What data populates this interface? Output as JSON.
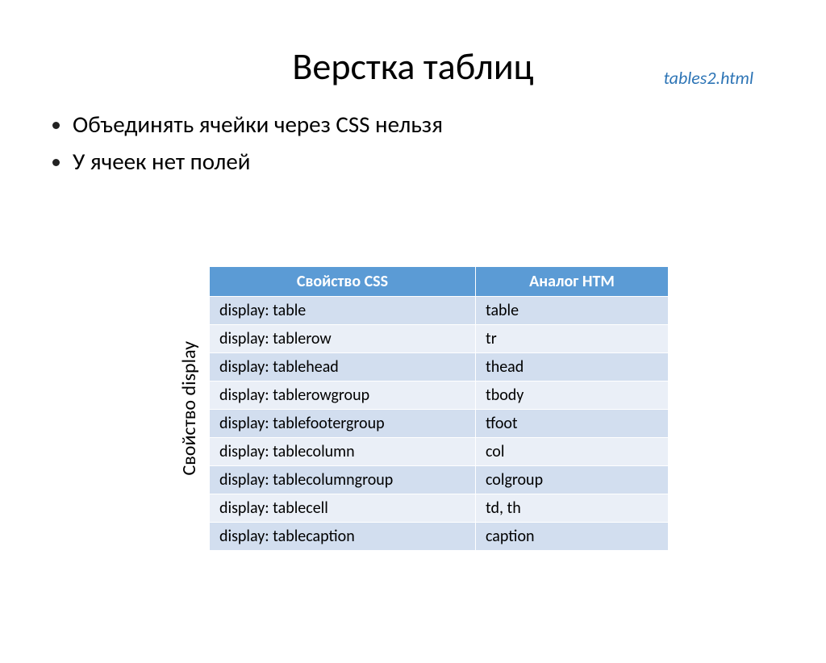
{
  "filename": "tables2.html",
  "title": "Верстка таблиц",
  "bullets": {
    "item0": "Объединять ячейки через CSS нельзя",
    "item1": "У ячеек нет полей"
  },
  "table": {
    "ylabel": "Свойство display",
    "headers": {
      "col0": "Свойство CSS",
      "col1": "Аналог HTM"
    },
    "rows": {
      "r0": {
        "c0": "display: table",
        "c1": "table"
      },
      "r1": {
        "c0": "display: tablerow",
        "c1": "tr"
      },
      "r2": {
        "c0": "display: tablehead",
        "c1": "thead"
      },
      "r3": {
        "c0": "display: tablerowgroup",
        "c1": "tbody"
      },
      "r4": {
        "c0": "display: tablefootergroup",
        "c1": "tfoot"
      },
      "r5": {
        "c0": "display: tablecolumn",
        "c1": "col"
      },
      "r6": {
        "c0": "display: tablecolumngroup",
        "c1": "colgroup"
      },
      "r7": {
        "c0": "display: tablecell",
        "c1": "td, th"
      },
      "r8": {
        "c0": "display: tablecaption",
        "c1": "caption"
      }
    }
  },
  "chart_data": {
    "type": "table",
    "title": "Верстка таблиц",
    "columns": [
      "Свойство CSS",
      "Аналог HTM"
    ],
    "rows": [
      [
        "display: table",
        "table"
      ],
      [
        "display: tablerow",
        "tr"
      ],
      [
        "display: tablehead",
        "thead"
      ],
      [
        "display: tablerowgroup",
        "tbody"
      ],
      [
        "display: tablefootergroup",
        "tfoot"
      ],
      [
        "display: tablecolumn",
        "col"
      ],
      [
        "display: tablecolumngroup",
        "colgroup"
      ],
      [
        "display: tablecell",
        "td, th"
      ],
      [
        "display: tablecaption",
        "caption"
      ]
    ]
  }
}
